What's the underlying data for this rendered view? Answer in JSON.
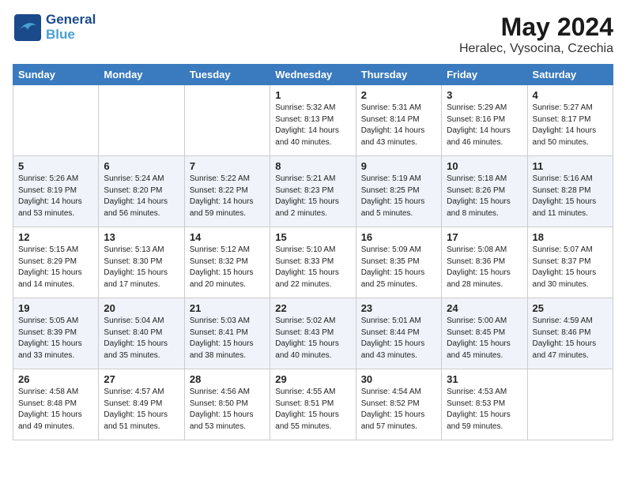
{
  "header": {
    "logo_general": "General",
    "logo_blue": "Blue",
    "title": "May 2024",
    "subtitle": "Heralec, Vysocina, Czechia"
  },
  "weekdays": [
    "Sunday",
    "Monday",
    "Tuesday",
    "Wednesday",
    "Thursday",
    "Friday",
    "Saturday"
  ],
  "weeks": [
    [
      {
        "day": "",
        "sunrise": "",
        "sunset": "",
        "daylight": ""
      },
      {
        "day": "",
        "sunrise": "",
        "sunset": "",
        "daylight": ""
      },
      {
        "day": "",
        "sunrise": "",
        "sunset": "",
        "daylight": ""
      },
      {
        "day": "1",
        "sunrise": "Sunrise: 5:32 AM",
        "sunset": "Sunset: 8:13 PM",
        "daylight": "Daylight: 14 hours and 40 minutes."
      },
      {
        "day": "2",
        "sunrise": "Sunrise: 5:31 AM",
        "sunset": "Sunset: 8:14 PM",
        "daylight": "Daylight: 14 hours and 43 minutes."
      },
      {
        "day": "3",
        "sunrise": "Sunrise: 5:29 AM",
        "sunset": "Sunset: 8:16 PM",
        "daylight": "Daylight: 14 hours and 46 minutes."
      },
      {
        "day": "4",
        "sunrise": "Sunrise: 5:27 AM",
        "sunset": "Sunset: 8:17 PM",
        "daylight": "Daylight: 14 hours and 50 minutes."
      }
    ],
    [
      {
        "day": "5",
        "sunrise": "Sunrise: 5:26 AM",
        "sunset": "Sunset: 8:19 PM",
        "daylight": "Daylight: 14 hours and 53 minutes."
      },
      {
        "day": "6",
        "sunrise": "Sunrise: 5:24 AM",
        "sunset": "Sunset: 8:20 PM",
        "daylight": "Daylight: 14 hours and 56 minutes."
      },
      {
        "day": "7",
        "sunrise": "Sunrise: 5:22 AM",
        "sunset": "Sunset: 8:22 PM",
        "daylight": "Daylight: 14 hours and 59 minutes."
      },
      {
        "day": "8",
        "sunrise": "Sunrise: 5:21 AM",
        "sunset": "Sunset: 8:23 PM",
        "daylight": "Daylight: 15 hours and 2 minutes."
      },
      {
        "day": "9",
        "sunrise": "Sunrise: 5:19 AM",
        "sunset": "Sunset: 8:25 PM",
        "daylight": "Daylight: 15 hours and 5 minutes."
      },
      {
        "day": "10",
        "sunrise": "Sunrise: 5:18 AM",
        "sunset": "Sunset: 8:26 PM",
        "daylight": "Daylight: 15 hours and 8 minutes."
      },
      {
        "day": "11",
        "sunrise": "Sunrise: 5:16 AM",
        "sunset": "Sunset: 8:28 PM",
        "daylight": "Daylight: 15 hours and 11 minutes."
      }
    ],
    [
      {
        "day": "12",
        "sunrise": "Sunrise: 5:15 AM",
        "sunset": "Sunset: 8:29 PM",
        "daylight": "Daylight: 15 hours and 14 minutes."
      },
      {
        "day": "13",
        "sunrise": "Sunrise: 5:13 AM",
        "sunset": "Sunset: 8:30 PM",
        "daylight": "Daylight: 15 hours and 17 minutes."
      },
      {
        "day": "14",
        "sunrise": "Sunrise: 5:12 AM",
        "sunset": "Sunset: 8:32 PM",
        "daylight": "Daylight: 15 hours and 20 minutes."
      },
      {
        "day": "15",
        "sunrise": "Sunrise: 5:10 AM",
        "sunset": "Sunset: 8:33 PM",
        "daylight": "Daylight: 15 hours and 22 minutes."
      },
      {
        "day": "16",
        "sunrise": "Sunrise: 5:09 AM",
        "sunset": "Sunset: 8:35 PM",
        "daylight": "Daylight: 15 hours and 25 minutes."
      },
      {
        "day": "17",
        "sunrise": "Sunrise: 5:08 AM",
        "sunset": "Sunset: 8:36 PM",
        "daylight": "Daylight: 15 hours and 28 minutes."
      },
      {
        "day": "18",
        "sunrise": "Sunrise: 5:07 AM",
        "sunset": "Sunset: 8:37 PM",
        "daylight": "Daylight: 15 hours and 30 minutes."
      }
    ],
    [
      {
        "day": "19",
        "sunrise": "Sunrise: 5:05 AM",
        "sunset": "Sunset: 8:39 PM",
        "daylight": "Daylight: 15 hours and 33 minutes."
      },
      {
        "day": "20",
        "sunrise": "Sunrise: 5:04 AM",
        "sunset": "Sunset: 8:40 PM",
        "daylight": "Daylight: 15 hours and 35 minutes."
      },
      {
        "day": "21",
        "sunrise": "Sunrise: 5:03 AM",
        "sunset": "Sunset: 8:41 PM",
        "daylight": "Daylight: 15 hours and 38 minutes."
      },
      {
        "day": "22",
        "sunrise": "Sunrise: 5:02 AM",
        "sunset": "Sunset: 8:43 PM",
        "daylight": "Daylight: 15 hours and 40 minutes."
      },
      {
        "day": "23",
        "sunrise": "Sunrise: 5:01 AM",
        "sunset": "Sunset: 8:44 PM",
        "daylight": "Daylight: 15 hours and 43 minutes."
      },
      {
        "day": "24",
        "sunrise": "Sunrise: 5:00 AM",
        "sunset": "Sunset: 8:45 PM",
        "daylight": "Daylight: 15 hours and 45 minutes."
      },
      {
        "day": "25",
        "sunrise": "Sunrise: 4:59 AM",
        "sunset": "Sunset: 8:46 PM",
        "daylight": "Daylight: 15 hours and 47 minutes."
      }
    ],
    [
      {
        "day": "26",
        "sunrise": "Sunrise: 4:58 AM",
        "sunset": "Sunset: 8:48 PM",
        "daylight": "Daylight: 15 hours and 49 minutes."
      },
      {
        "day": "27",
        "sunrise": "Sunrise: 4:57 AM",
        "sunset": "Sunset: 8:49 PM",
        "daylight": "Daylight: 15 hours and 51 minutes."
      },
      {
        "day": "28",
        "sunrise": "Sunrise: 4:56 AM",
        "sunset": "Sunset: 8:50 PM",
        "daylight": "Daylight: 15 hours and 53 minutes."
      },
      {
        "day": "29",
        "sunrise": "Sunrise: 4:55 AM",
        "sunset": "Sunset: 8:51 PM",
        "daylight": "Daylight: 15 hours and 55 minutes."
      },
      {
        "day": "30",
        "sunrise": "Sunrise: 4:54 AM",
        "sunset": "Sunset: 8:52 PM",
        "daylight": "Daylight: 15 hours and 57 minutes."
      },
      {
        "day": "31",
        "sunrise": "Sunrise: 4:53 AM",
        "sunset": "Sunset: 8:53 PM",
        "daylight": "Daylight: 15 hours and 59 minutes."
      },
      {
        "day": "",
        "sunrise": "",
        "sunset": "",
        "daylight": ""
      }
    ]
  ]
}
